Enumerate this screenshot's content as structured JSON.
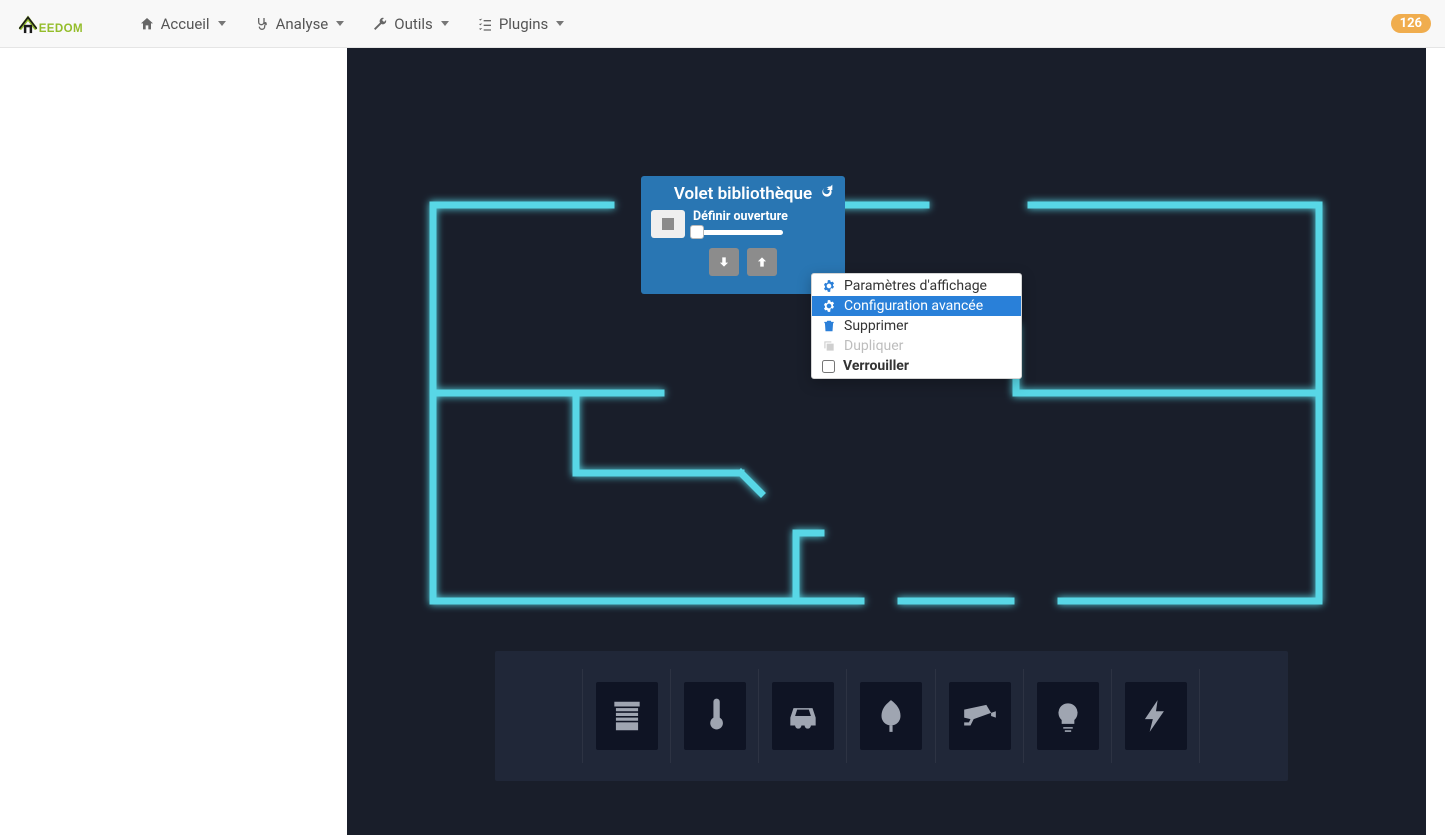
{
  "nav": {
    "brand": "JEEDOM",
    "items": [
      {
        "label": "Accueil",
        "icon": "home"
      },
      {
        "label": "Analyse",
        "icon": "stethoscope"
      },
      {
        "label": "Outils",
        "icon": "wrench"
      },
      {
        "label": "Plugins",
        "icon": "list-check"
      }
    ],
    "badge": "126"
  },
  "widget": {
    "title": "Volet bibliothèque",
    "slider_label": "Définir ouverture",
    "slider_value": 0
  },
  "context_menu": {
    "items": [
      {
        "label": "Paramètres d'affichage",
        "icon": "gears",
        "state": "normal"
      },
      {
        "label": "Configuration avancée",
        "icon": "gear",
        "state": "hover"
      },
      {
        "label": "Supprimer",
        "icon": "trash",
        "state": "normal"
      },
      {
        "label": "Dupliquer",
        "icon": "copy",
        "state": "disabled"
      }
    ],
    "lock_label": "Verrouiller",
    "lock_checked": false
  },
  "toolbar": {
    "items": [
      {
        "name": "shutter",
        "label": "icon-shutter"
      },
      {
        "name": "thermo",
        "label": "icon-thermometer"
      },
      {
        "name": "car",
        "label": "icon-car"
      },
      {
        "name": "tree",
        "label": "icon-tree"
      },
      {
        "name": "camera",
        "label": "icon-cctv"
      },
      {
        "name": "lightbulb",
        "label": "icon-lightbulb"
      },
      {
        "name": "bolt",
        "label": "icon-bolt"
      }
    ],
    "pad_cells": 2
  },
  "colors": {
    "canvas_bg": "#191e2a",
    "wall_neon": "#58d7e6",
    "widget_bg": "#2976b3",
    "widget_glow": "#ff0000",
    "toolbar_glow": "#a0d23c",
    "badge_bg": "#f0ad4e"
  }
}
